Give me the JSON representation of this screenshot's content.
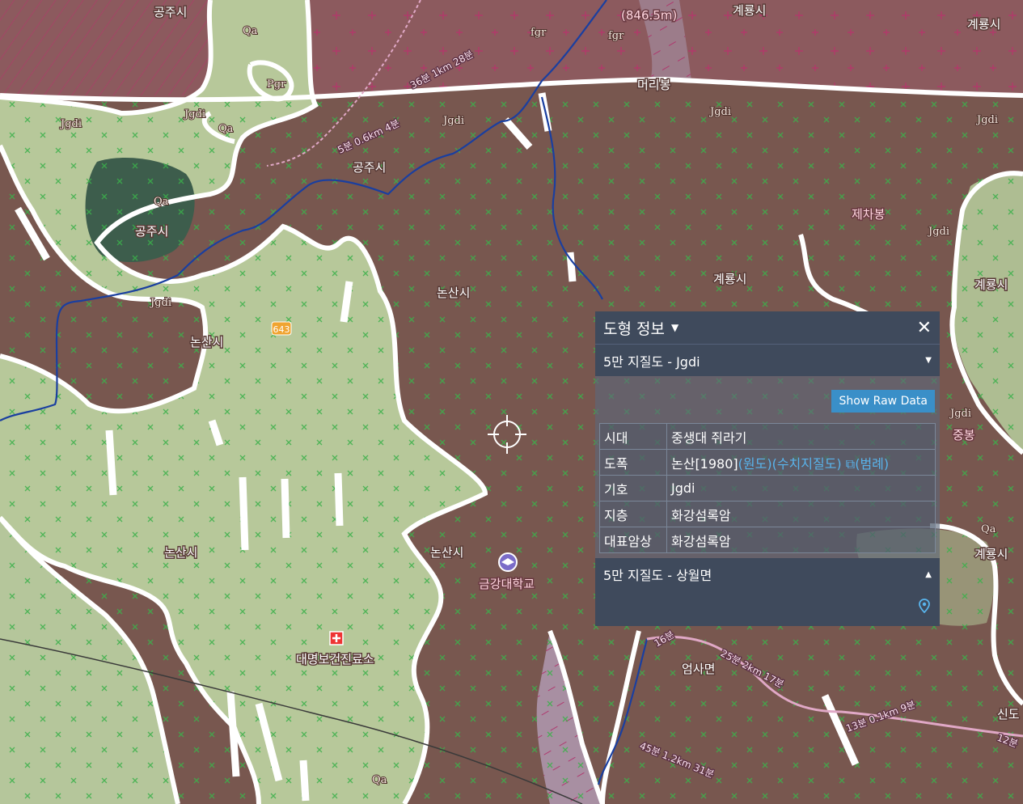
{
  "colors": {
    "granite": "#7b5a52",
    "alluvium": "#b9c99a",
    "wall_pink": "#8c4f63",
    "boundary": "#ffffff",
    "stream": "#1a3fa0",
    "panel_bg": "#3f4a5c",
    "button": "#3a8fc8",
    "link": "#59b4ec"
  },
  "map": {
    "place_labels": [
      "공주시",
      "공주시",
      "공주시",
      "공주시",
      "논산시",
      "논산시",
      "논산시",
      "논산시",
      "논산시",
      "계룡시",
      "계룡시",
      "계룡시",
      "계룡시",
      "계룡시",
      "제차봉",
      "중봉",
      "엄사면",
      "대명보건진료소",
      "금강대학교",
      "머리봉",
      "신도"
    ],
    "peak_elevation": "(846.5m)",
    "road_number": "643",
    "geo_codes": [
      "Jgdi",
      "Qa",
      "fgr",
      "Pgr"
    ],
    "trail_labels": [
      "36분 1km 28분",
      "5분 0.6km 4분",
      "16분",
      "25분 2km 17분",
      "13분 0.1km 9분",
      "12분",
      "45분 1.2km 31분"
    ]
  },
  "panel": {
    "title": "도형 정보",
    "close_label": "✕",
    "section1": "5만 지질도 - Jgdi",
    "raw_button": "Show Raw Data",
    "rows": [
      {
        "key": "시대",
        "value": "중생대 쥐라기"
      },
      {
        "key": "도폭",
        "value": "논산[1980]",
        "links": [
          "(원도)",
          "(수치지질도)",
          "(범례)"
        ]
      },
      {
        "key": "기호",
        "value": "Jgdi"
      },
      {
        "key": "지층",
        "value": "화강섬록암"
      },
      {
        "key": "대표암상",
        "value": "화강섬록암"
      }
    ],
    "section2": "5만 지질도 - 상월면"
  }
}
